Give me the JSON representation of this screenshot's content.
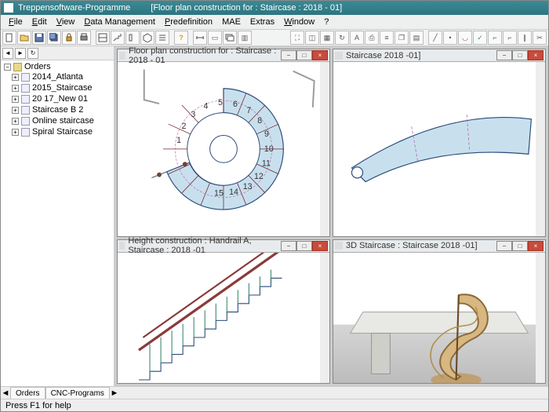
{
  "app": {
    "title": "Treppensoftware-Programme",
    "document": "[Floor plan construction for : Staircase : 2018 - 01]"
  },
  "menu": {
    "file": "File",
    "edit": "Edit",
    "view": "View",
    "data": "Data Management",
    "pred": "Predefinition",
    "mae": "MAE",
    "extras": "Extras",
    "window": "Window",
    "help": "?"
  },
  "tree": {
    "root": "Orders",
    "items": [
      {
        "label": "2014_Atlanta"
      },
      {
        "label": "2015_Staircase"
      },
      {
        "label": "20 17_New 01"
      },
      {
        "label": "Staircase B 2"
      },
      {
        "label": "Online staircase"
      },
      {
        "label": "Spiral Staircase"
      }
    ]
  },
  "tabs": {
    "orders": "Orders",
    "cnc": "CNC-Programs"
  },
  "panes": {
    "floorplan": "Floor plan construction for : Staircase : 2018 - 01",
    "stair": "Staircase 2018 -01]",
    "height": "Height construction : Handrail A, Staircase : 2018 -01",
    "view3d": "3D Staircase : Staircase 2018 -01]"
  },
  "step_labels": [
    "1",
    "2",
    "3",
    "4",
    "5",
    "6",
    "7",
    "8",
    "9",
    "10",
    "11",
    "12",
    "13",
    "14",
    "15"
  ],
  "status": "Press  F1  for help"
}
